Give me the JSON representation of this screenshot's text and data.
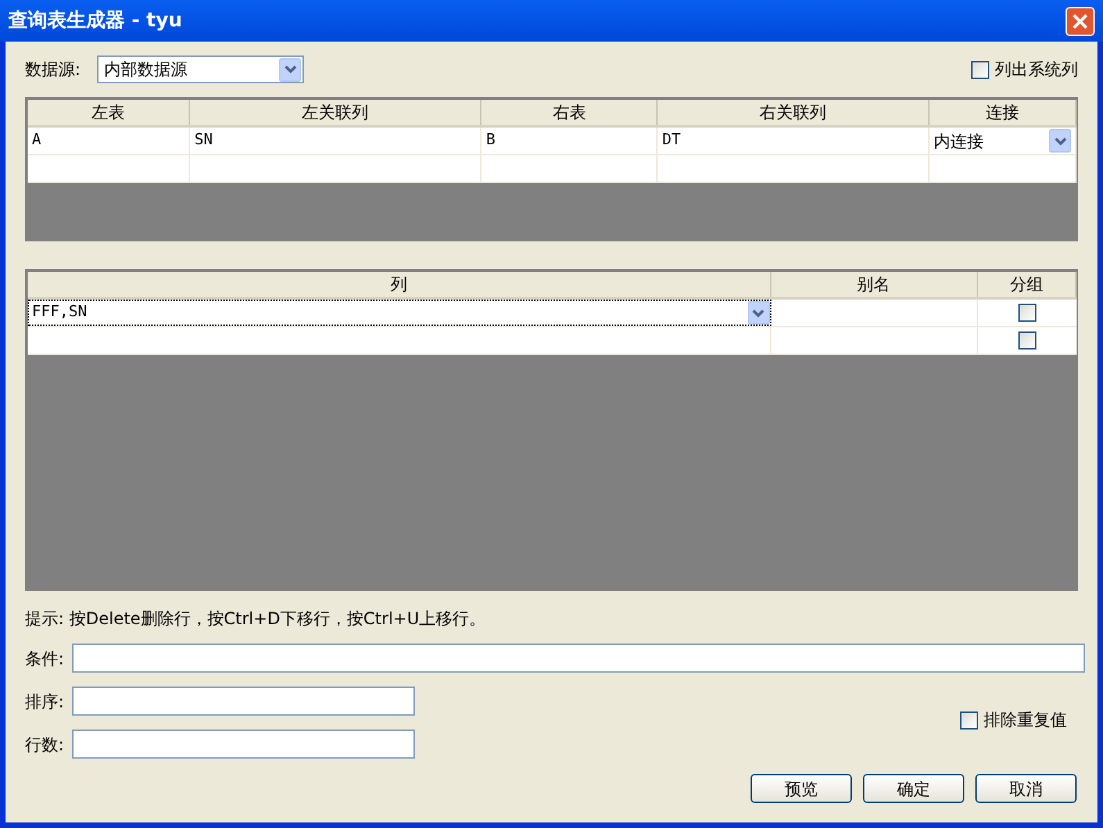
{
  "window": {
    "title": "查询表生成器 - tyu"
  },
  "datasource": {
    "label": "数据源:",
    "value": "内部数据源"
  },
  "show_system_columns": {
    "label": "列出系统列",
    "checked": false
  },
  "join_table": {
    "columns": [
      "左表",
      "左关联列",
      "右表",
      "右关联列",
      "连接"
    ],
    "rows": [
      {
        "cells": [
          "A",
          "SN",
          "B",
          "DT",
          "内连接"
        ]
      },
      {
        "cells": []
      }
    ]
  },
  "column_table": {
    "columns": [
      "列",
      "别名",
      "分组"
    ],
    "rows": [
      {
        "column": "FFF,SN",
        "focused": true,
        "group": false
      },
      {
        "column": "",
        "focused": false,
        "group": false
      }
    ]
  },
  "hint": "提示: 按Delete删除行，按Ctrl+D下移行，按Ctrl+U上移行。",
  "fields": [
    {
      "label": "条件:",
      "wide": true
    },
    {
      "label": "排序:",
      "wide": false
    },
    {
      "label": "行数:",
      "wide": false
    }
  ],
  "distinct": {
    "label": "排除重复值",
    "checked": false
  },
  "buttons": [
    "预览",
    "确定",
    "取消"
  ]
}
